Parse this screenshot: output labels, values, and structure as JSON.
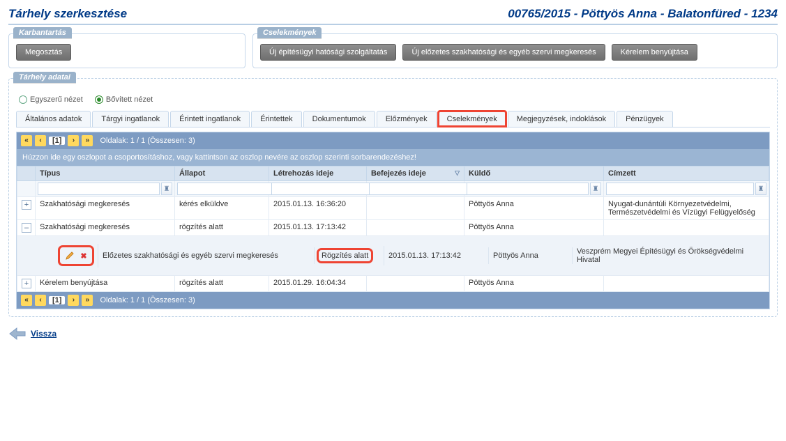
{
  "header": {
    "title": "Tárhely szerkesztése",
    "case": "00765/2015 - Pöttyös Anna - Balatonfüred - 1234"
  },
  "maintenance": {
    "legend": "Karbantartás",
    "share_label": "Megosztás"
  },
  "actions": {
    "legend": "Cselekmények",
    "btn1": "Új építésügyi hatósági szolgáltatás",
    "btn2": "Új előzetes szakhatósági és egyéb szervi megkeresés",
    "btn3": "Kérelem benyújtása"
  },
  "data_panel": {
    "legend": "Tárhely adatai",
    "view_simple": "Egyszerű nézet",
    "view_extended": "Bővített nézet"
  },
  "tabs": [
    {
      "label": "Általános adatok"
    },
    {
      "label": "Tárgyi ingatlanok"
    },
    {
      "label": "Érintett ingatlanok"
    },
    {
      "label": "Érintettek"
    },
    {
      "label": "Dokumentumok"
    },
    {
      "label": "Előzmények"
    },
    {
      "label": "Cselekmények",
      "highlight": true
    },
    {
      "label": "Megjegyzések, indoklások"
    },
    {
      "label": "Pénzügyek"
    }
  ],
  "pager": {
    "current": "[1]",
    "text": "Oldalak: 1 / 1 (Összesen: 3)"
  },
  "group_hint": "Húzzon ide egy oszlopot a csoportosításhoz, vagy kattintson az oszlop nevére az oszlop szerinti sorbarendezéshez!",
  "columns": {
    "c1": "Típus",
    "c2": "Állapot",
    "c3": "Létrehozás ideje",
    "c4": "Befejezés ideje",
    "c5": "Küldő",
    "c6": "Címzett"
  },
  "rows": [
    {
      "exp": "+",
      "tipus": "Szakhatósági megkeresés",
      "allapot": "kérés elküldve",
      "letre": "2015.01.13. 16:36:20",
      "befej": "",
      "kuldo": "Pöttyös Anna",
      "cimzett": "Nyugat-dunántúli Környezetvédelmi, Természetvédelmi és Vízügyi Felügyelőség"
    },
    {
      "exp": "–",
      "tipus": "Szakhatósági megkeresés",
      "allapot": "rögzítés alatt",
      "letre": "2015.01.13. 17:13:42",
      "befej": "",
      "kuldo": "Pöttyös Anna",
      "cimzett": "",
      "expanded": true,
      "detail": {
        "tipus": "Előzetes szakhatósági és egyéb szervi megkeresés",
        "allapot": "Rögzítés alatt",
        "letre": "2015.01.13. 17:13:42",
        "kuldo": "Pöttyös Anna",
        "cimzett": "Veszprém Megyei Építésügyi és Örökségvédelmi Hivatal"
      }
    },
    {
      "exp": "+",
      "tipus": "Kérelem benyújtása",
      "allapot": "rögzítés alatt",
      "letre": "2015.01.29. 16:04:34",
      "befej": "",
      "kuldo": "Pöttyös Anna",
      "cimzett": ""
    }
  ],
  "back": {
    "label": "Vissza"
  }
}
